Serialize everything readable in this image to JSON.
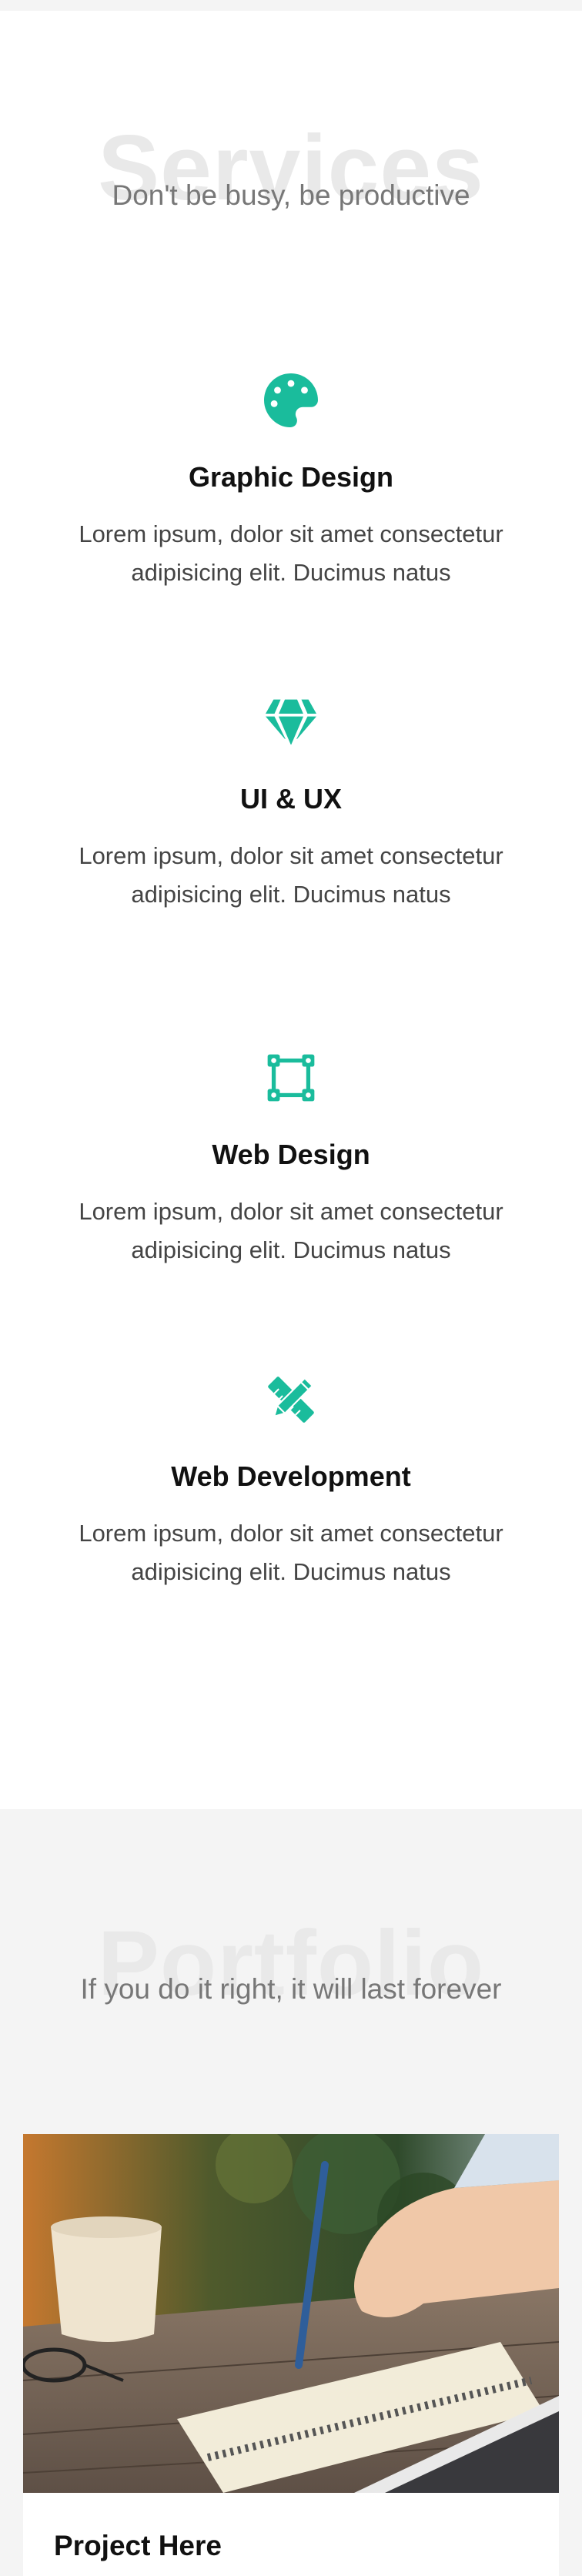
{
  "services": {
    "bg_title": "Services",
    "subtitle": "Don't be busy, be productive",
    "items": [
      {
        "icon": "palette-icon",
        "title": "Graphic Design",
        "description": "Lorem ipsum, dolor sit amet consectetur adipisicing elit. Ducimus natus"
      },
      {
        "icon": "gem-icon",
        "title": "UI & UX",
        "description": "Lorem ipsum, dolor sit amet consectetur adipisicing elit. Ducimus natus"
      },
      {
        "icon": "vector-square-icon",
        "title": "Web Design",
        "description": "Lorem ipsum, dolor sit amet consectetur adipisicing elit. Ducimus natus"
      },
      {
        "icon": "pencil-ruler-icon",
        "title": "Web Development",
        "description": "Lorem ipsum, dolor sit amet consectetur adipisicing elit. Ducimus natus"
      }
    ]
  },
  "portfolio": {
    "bg_title": "Portfolio",
    "subtitle": "If you do it right, it will last forever",
    "projects": [
      {
        "title": "Project Here"
      }
    ]
  },
  "colors": {
    "accent": "#1abc9c",
    "section_bg": "#f4f4f4"
  }
}
